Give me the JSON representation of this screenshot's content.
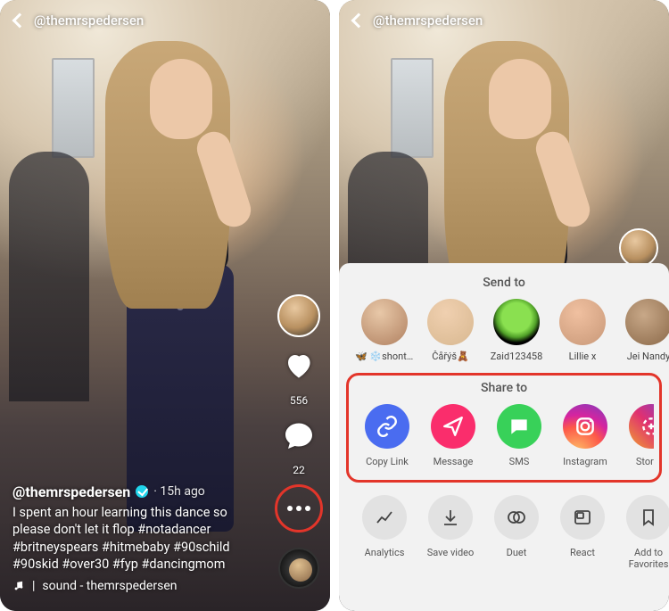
{
  "left": {
    "username_handle": "@themrspedersen",
    "meta": " · 15h ago",
    "caption_text": "I spent an hour learning this dance so please don't let it flop #notadancer #britneyspears #hitmebaby #90schild #90skid #over30 #fyp #dancingmom",
    "sound_label": "sound - themrspedersen",
    "likes": "556",
    "comments": "22"
  },
  "right": {
    "username_handle": "@themrspedersen",
    "send_to_label": "Send to",
    "share_to_label": "Share to",
    "friends": [
      {
        "name": "🦋 ❄️shontell..."
      },
      {
        "name": "Čåřýš🧸"
      },
      {
        "name": "Zaid123458"
      },
      {
        "name": "Lillie x"
      },
      {
        "name": "Jei Nandy"
      }
    ],
    "share_targets": [
      {
        "id": "copy-link",
        "label": "Copy Link"
      },
      {
        "id": "message",
        "label": "Message"
      },
      {
        "id": "sms",
        "label": "SMS"
      },
      {
        "id": "instagram",
        "label": "Instagram"
      },
      {
        "id": "stories",
        "label": "Stories"
      }
    ],
    "actions": [
      {
        "id": "analytics",
        "label": "Analytics"
      },
      {
        "id": "save",
        "label": "Save video"
      },
      {
        "id": "duet",
        "label": "Duet"
      },
      {
        "id": "react",
        "label": "React"
      },
      {
        "id": "favorite",
        "label": "Add to Favorites"
      }
    ]
  }
}
